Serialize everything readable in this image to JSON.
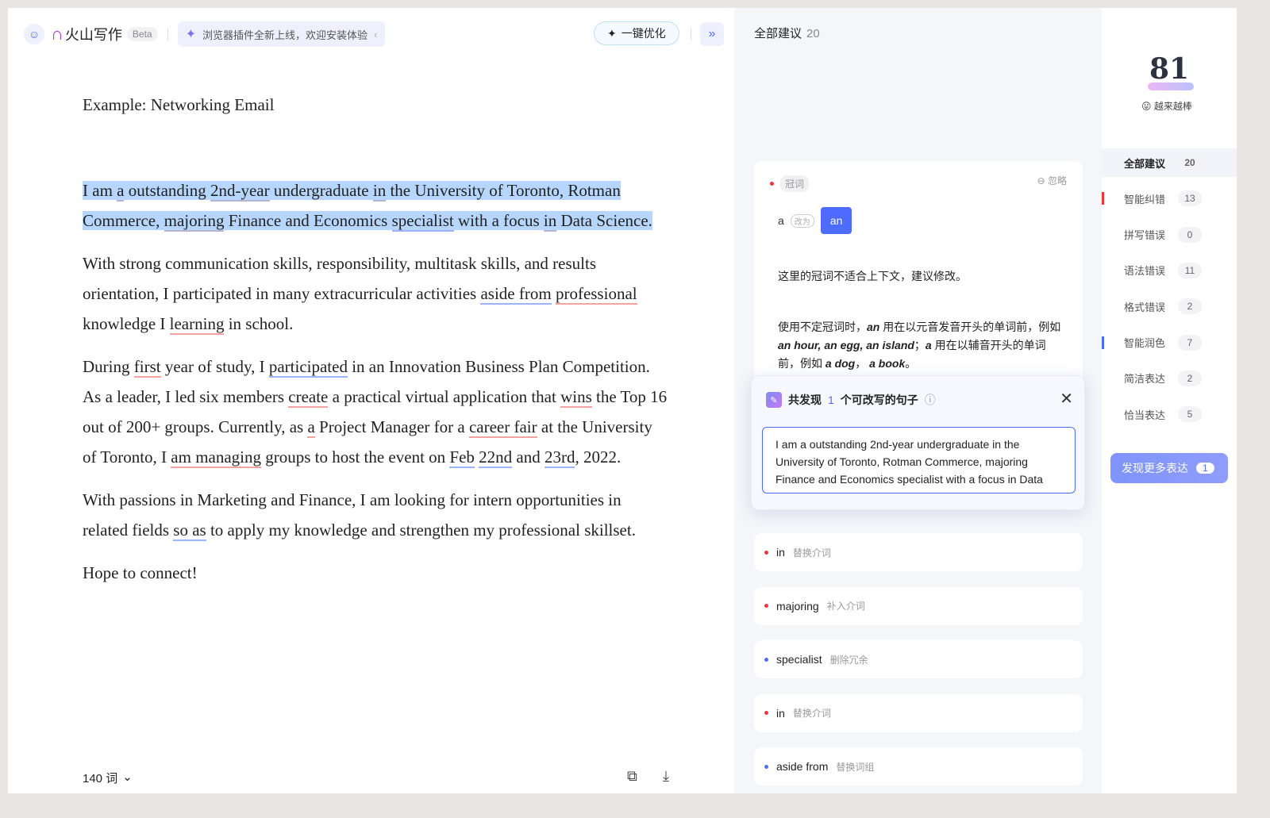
{
  "header": {
    "app_name": "火山写作",
    "beta": "Beta",
    "banner": "浏览器插件全新上线，欢迎安装体验",
    "optimize": "一键优化"
  },
  "document": {
    "title": "Example: Networking Email",
    "paragraphs": [
      {
        "selected": true,
        "segments": [
          {
            "t": "I am "
          },
          {
            "t": "a",
            "m": "gray"
          },
          {
            "t": " outstanding "
          },
          {
            "t": "2nd-year",
            "m": "gray"
          },
          {
            "t": " undergraduate "
          },
          {
            "t": "in",
            "m": "gray"
          },
          {
            "t": " the University of Toronto, Rotman Commerce, "
          },
          {
            "t": "majoring",
            "m": "gray"
          },
          {
            "t": " Finance and Economics "
          },
          {
            "t": "specialist",
            "m": "blue"
          },
          {
            "t": " with a focus "
          },
          {
            "t": "in",
            "m": "gray"
          },
          {
            "t": " Data Science."
          }
        ]
      },
      {
        "segments": [
          {
            "t": "With strong communication skills, responsibility, multitask skills, and results orientation, I participated in many extracurricular activities "
          },
          {
            "t": "aside from",
            "m": "blue"
          },
          {
            "t": " "
          },
          {
            "t": "professional",
            "m": "red"
          },
          {
            "t": " knowledge I "
          },
          {
            "t": "learning",
            "m": "red"
          },
          {
            "t": " in school."
          }
        ]
      },
      {
        "segments": [
          {
            "t": "During "
          },
          {
            "t": "first",
            "m": "red"
          },
          {
            "t": " year of study, I "
          },
          {
            "t": "participated",
            "m": "blue"
          },
          {
            "t": " in an Innovation Business Plan Competition. As a leader, I led six members "
          },
          {
            "t": "create",
            "m": "red"
          },
          {
            "t": " a practical virtual application that "
          },
          {
            "t": "wins",
            "m": "red"
          },
          {
            "t": " the Top 16 out of 200+ groups. Currently, as "
          },
          {
            "t": "a",
            "m": "red"
          },
          {
            "t": " Project Manager for a "
          },
          {
            "t": "career fair",
            "m": "red"
          },
          {
            "t": " at the University of Toronto, I "
          },
          {
            "t": "am managing",
            "m": "red"
          },
          {
            "t": " groups to host the event on "
          },
          {
            "t": "Feb",
            "m": "blue"
          },
          {
            "t": " "
          },
          {
            "t": "22nd",
            "m": "blue"
          },
          {
            "t": " and "
          },
          {
            "t": "23rd",
            "m": "blue"
          },
          {
            "t": ", 2022."
          }
        ]
      },
      {
        "segments": [
          {
            "t": "With passions in Marketing and Finance, I am looking for intern opportunities in related fields "
          },
          {
            "t": "so as",
            "m": "blue"
          },
          {
            "t": " to apply my knowledge and strengthen my professional skillset."
          }
        ]
      },
      {
        "segments": [
          {
            "t": "Hope to connect!"
          }
        ]
      }
    ],
    "word_count": "140 词"
  },
  "panel": {
    "title": "全部建议",
    "count": "20",
    "main_card": {
      "tag": "冠词",
      "ignore": "忽略",
      "from": "a",
      "arrow": "改为",
      "to": "an",
      "explain": "这里的冠词不适合上下文，建议修改。",
      "rule_html": "使用不定冠词时，<b><i>an</i></b> 用在以元音发音开头的单词前，例如 <b><i>an hour, an egg, an island</i></b>；<b><i>a</i></b> 用在以辅音开头的单词前，例如 <b><i>a dog</i></b>， <b><i>a book</i></b>。"
    },
    "popup": {
      "prefix": "共发现",
      "num": "1",
      "suffix": "个可改写的句子",
      "sentence": "I am a outstanding 2nd-year undergraduate in the University of Toronto, Rotman Commerce, majoring Finance and Economics specialist with a focus in Data Science."
    },
    "items": [
      {
        "word": "in",
        "hint": "替换介词",
        "color": "#f0353b"
      },
      {
        "word": "majoring",
        "hint": "补入介词",
        "color": "#f0353b"
      },
      {
        "word": "specialist",
        "hint": "删除冗余",
        "color": "#4d6bfe"
      },
      {
        "word": "in",
        "hint": "替换介词",
        "color": "#f0353b"
      },
      {
        "word": "aside from",
        "hint": "替换词组",
        "color": "#4d6bfe"
      }
    ]
  },
  "sidebar": {
    "score": "81",
    "mood": "越来越棒",
    "nav": [
      {
        "label": "全部建议",
        "count": "20",
        "active": true
      },
      {
        "label": "智能纠错",
        "count": "13",
        "bar": "#f0353b"
      },
      {
        "label": "拼写错误",
        "count": "0"
      },
      {
        "label": "语法错误",
        "count": "11"
      },
      {
        "label": "格式错误",
        "count": "2"
      },
      {
        "label": "智能润色",
        "count": "7",
        "bar": "#4d6bfe"
      },
      {
        "label": "简洁表达",
        "count": "2"
      },
      {
        "label": "恰当表达",
        "count": "5"
      }
    ],
    "more": "发现更多表达",
    "more_count": "1"
  }
}
